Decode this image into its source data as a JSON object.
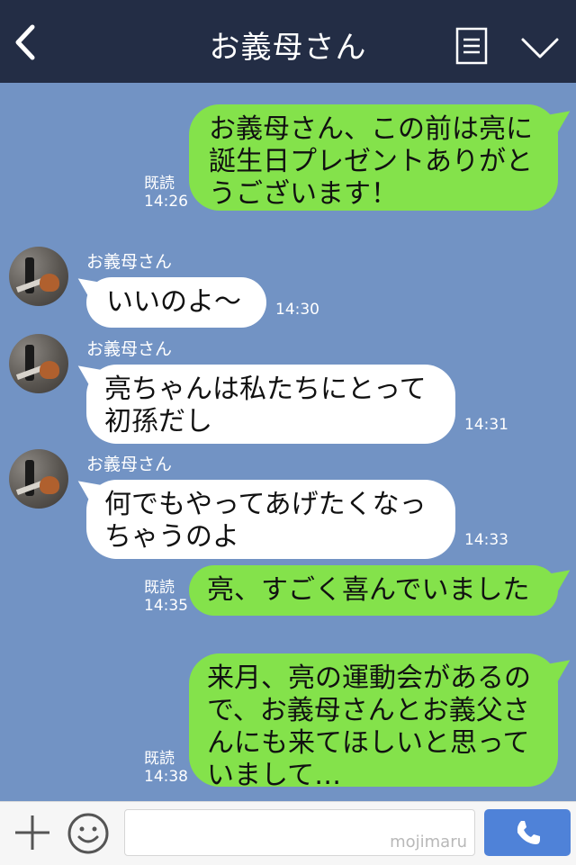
{
  "header": {
    "title": "お義母さん",
    "back_icon": "chevron-left-icon",
    "menu_icon": "menu-lines-icon",
    "expand_icon": "chevron-down-icon"
  },
  "colors": {
    "background": "#7293c4",
    "header": "#232d45",
    "my_bubble": "#84e24b",
    "their_bubble": "#ffffff",
    "send_button": "#4f82d8"
  },
  "messages": [
    {
      "from": "me",
      "text": "お義母さん、この前は亮に\n誕生日プレゼントありがと\nうございます！",
      "read": "既読",
      "time": "14:26"
    },
    {
      "from": "them",
      "sender": "お義母さん",
      "text": "いいのよ〜",
      "time": "14:30"
    },
    {
      "from": "them",
      "sender": "お義母さん",
      "text": "亮ちゃんは私たちにとって\n初孫だし",
      "time": "14:31"
    },
    {
      "from": "them",
      "sender": "お義母さん",
      "text": "何でもやってあげたくなっ\nちゃうのよ",
      "time": "14:33"
    },
    {
      "from": "me",
      "text": "亮、すごく喜んでいました",
      "read": "既読",
      "time": "14:35"
    },
    {
      "from": "me",
      "text": "来月、亮の運動会があるの\nで、お義母さんとお義父さ\nんにも来てほしいと思って\nいまして…",
      "read": "既読",
      "time": "14:38"
    }
  ],
  "footer": {
    "plus_icon": "plus-icon",
    "emoji_icon": "smiley-icon",
    "input_value": "",
    "watermark": "mojimaru",
    "call_icon": "phone-icon"
  }
}
